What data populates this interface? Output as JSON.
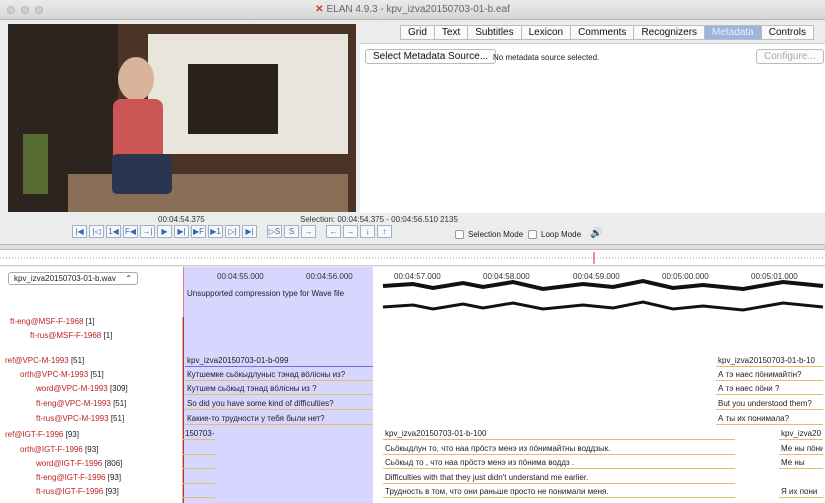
{
  "window": {
    "title": "ELAN 4.9.3 - kpv_izva20150703-01-b.eaf",
    "logo": "ELAN logo"
  },
  "tabs": [
    "Grid",
    "Text",
    "Subtitles",
    "Lexicon",
    "Comments",
    "Recognizers",
    "Metadata",
    "Controls"
  ],
  "metadata": {
    "select_label": "Select Metadata Source...",
    "hint": "No metadata source selected.",
    "configure_label": "Configure..."
  },
  "player": {
    "current_time": "00:04:54.375",
    "selection": "Selection: 00:04:54.375 - 00:04:56.510  2135",
    "selection_mode": "Selection Mode",
    "loop_mode": "Loop Mode"
  },
  "waveform": {
    "file": "kpv_izva20150703-01-b.wav",
    "error": "Unsupported compression type for Wave file",
    "ticks": [
      "00:04:55.000",
      "00:04:56.000",
      "00:04:57.000",
      "00:04:58.000",
      "00:04:59.000",
      "00:05:00.000",
      "00:05:01.000"
    ]
  },
  "tiers": [
    {
      "name": "ft-eng@MSF-F-1968",
      "count": "[1]"
    },
    {
      "name": "ft-rus@MSF-F-1968",
      "count": "[1]"
    },
    {
      "name": "ref@VPC-M-1993",
      "count": "[51]"
    },
    {
      "name": "orth@VPC-M-1993",
      "count": "[51]"
    },
    {
      "name": "word@VPC-M-1993",
      "count": "[309]"
    },
    {
      "name": "ft-eng@VPC-M-1993",
      "count": "[51]"
    },
    {
      "name": "ft-rus@VPC-M-1993",
      "count": "[51]"
    },
    {
      "name": "ref@IGT-F-1996",
      "count": "[93]"
    },
    {
      "name": "orth@IGT-F-1996",
      "count": "[93]"
    },
    {
      "name": "word@IGT-F-1996",
      "count": "[806]"
    },
    {
      "name": "ft-eng@IGT-F-1996",
      "count": "[93]"
    },
    {
      "name": "ft-rus@IGT-F-1996",
      "count": "[93]"
    }
  ],
  "annotations": {
    "ref1": "kpv_izva20150703-01-b-099",
    "ref1b": "kpv_izva20150703-01-b-10",
    "orth1": "Кутшемке сьӧкыдлуныс тэнад вӧлісны из?",
    "orth1b": "А тэ наес пӧнимайтін?",
    "word1": "Кутшем сьӧкыд тэнад вӧлісны из ?",
    "word1b": "А тэ наес пӧни ?",
    "eng1": "So did you have some kind of difficulties?",
    "eng1b": "But you understood them?",
    "rus1": "Какие-то трудности у тебя были нет?",
    "rus1b": "А ты их понимала?",
    "ref2a": "150703-",
    "ref2": "kpv_izva20150703-01-b-100",
    "ref2b": "kpv_izva20",
    "orth2": "Сьӧкыдлун то, что наа прӧстэ менэ из пӧнимайтны воддзык.",
    "orth2b": "Ме ны пӧни",
    "word2": "Сьӧкыд то , что наа прӧстэ менэ из пӧнима воддз .",
    "word2b": "Ме ны",
    "eng2": "Difficulties with that they just didn't understand me earlier.",
    "rus2": "Трудность в том, что они раньше просто не понимали меня.",
    "rus2b": "Я их пони"
  }
}
